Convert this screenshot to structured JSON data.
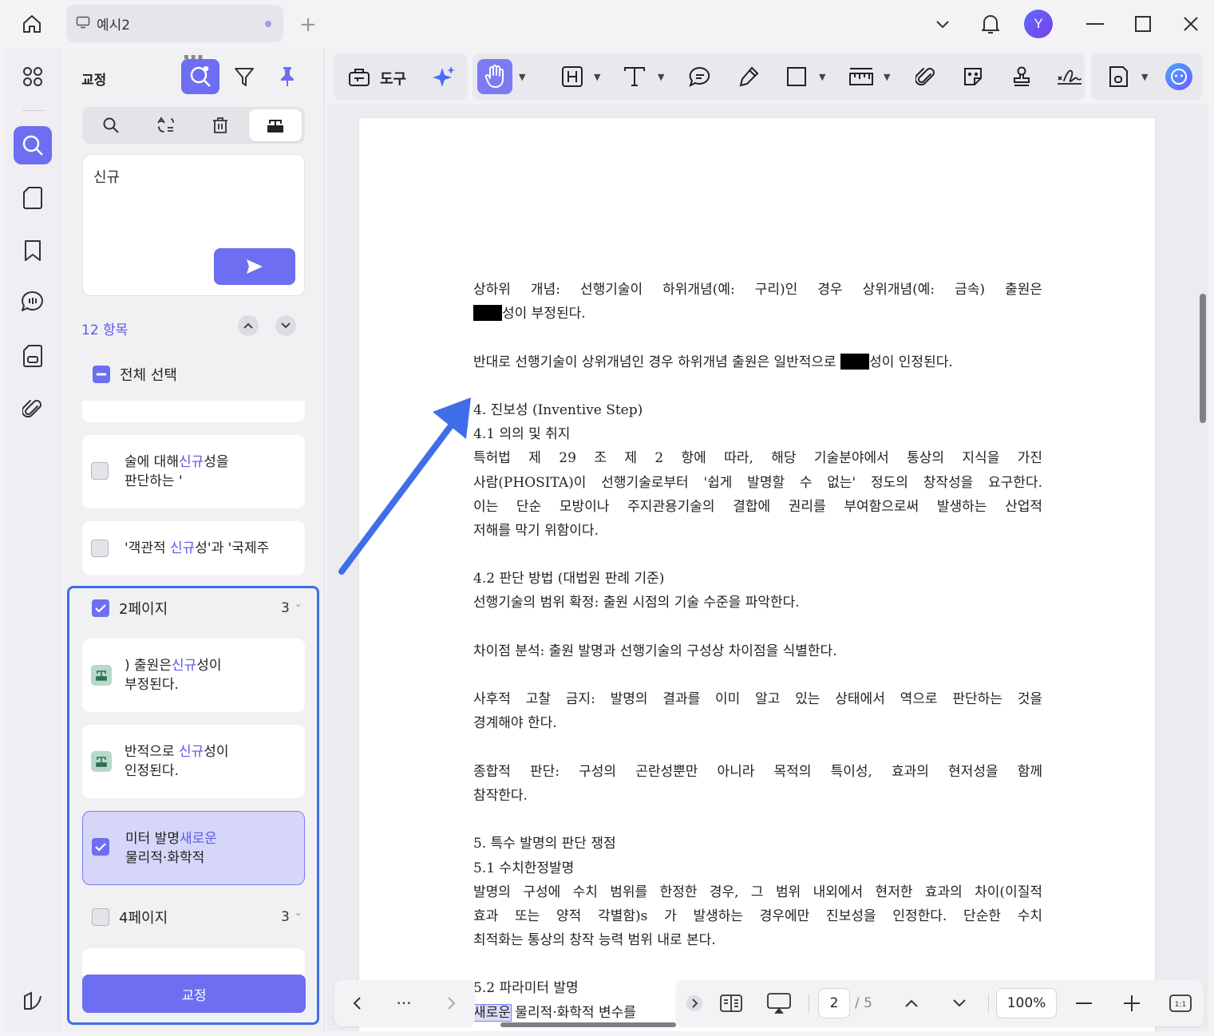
{
  "titlebar": {
    "tab_title": "예시2",
    "avatar_letter": "Y"
  },
  "panel": {
    "title": "교정",
    "search_query": "신규",
    "result_count": "12 항목",
    "select_all": "전체 선택",
    "apply_label": "교정",
    "results": [
      {
        "pre": "술에 대해",
        "hit": "신규",
        "post": "성을",
        "line2": "판단하는 '",
        "checked": false
      },
      {
        "pre": "'객관적 ",
        "hit": "신규",
        "post": "성'과 '국제주",
        "line2": "",
        "checked": false
      }
    ],
    "page_groups": [
      {
        "label": "2페이지",
        "count": "3",
        "checked": true,
        "items": [
          {
            "pre": ") 출원은",
            "hit": "신규",
            "post": "성이",
            "line2": "부정된다.",
            "type": "redacted"
          },
          {
            "pre": "반적으로 ",
            "hit": "신규",
            "post": "성이",
            "line2": "인정된다.",
            "type": "redacted"
          },
          {
            "pre": "미터 발명",
            "hit": "새로운",
            "post": "",
            "line2": "물리적·화학적",
            "type": "checked"
          }
        ]
      },
      {
        "label": "4페이지",
        "count": "3",
        "checked": false
      }
    ]
  },
  "toolbar": {
    "tools_label": "도구"
  },
  "document": {
    "lines": [
      {
        "text": "상하위 개념: 선행기술이 하위개념(예: 구리)인 경우 상위개념(예: 금속) 출원은",
        "just": true
      },
      {
        "pre": "",
        "redact": true,
        "post": "성이 부정된다.",
        "just": false
      },
      {
        "text": "",
        "just": false
      },
      {
        "pre": "반대로 선행기술이 상위개념인 경우 하위개념 출원은 일반적으로 ",
        "redact": true,
        "post": "성이 인정된다.",
        "just": false
      },
      {
        "text": "",
        "just": false
      },
      {
        "text": "4. 진보성 (Inventive Step)",
        "just": false
      },
      {
        "text": "4.1 의의 및 취지",
        "just": false
      },
      {
        "text": "특허법 제 29 조 제 2 항에 따라, 해당 기술분야에서 통상의 지식을 가진",
        "just": true
      },
      {
        "text": "사람(PHOSITA)이 선행기술로부터 '쉽게 발명할 수 없는' 정도의 창작성을 요구한다.",
        "just": true
      },
      {
        "text": "이는 단순 모방이나 주지관용기술의 결합에 권리를 부여함으로써 발생하는 산업적",
        "just": true
      },
      {
        "text": "저해를 막기 위함이다.",
        "just": false
      },
      {
        "text": "",
        "just": false
      },
      {
        "text": "4.2 판단 방법 (대법원 판례 기준)",
        "just": false
      },
      {
        "text": "선행기술의 범위 확정: 출원 시점의 기술 수준을 파악한다.",
        "just": false
      },
      {
        "text": "",
        "just": false
      },
      {
        "text": "차이점 분석: 출원 발명과 선행기술의 구성상 차이점을 식별한다.",
        "just": false
      },
      {
        "text": "",
        "just": false
      },
      {
        "text": "사후적 고찰 금지: 발명의 결과를 이미 알고 있는 상태에서 역으로 판단하는 것을",
        "just": true
      },
      {
        "text": "경계해야 한다.",
        "just": false
      },
      {
        "text": "",
        "just": false
      },
      {
        "text": "종합적 판단: 구성의 곤란성뿐만 아니라 목적의 특이성, 효과의 현저성을 함께",
        "just": true
      },
      {
        "text": "참작한다.",
        "just": false
      },
      {
        "text": "",
        "just": false
      },
      {
        "text": "5. 특수 발명의 판단 쟁점",
        "just": false
      },
      {
        "text": "5.1 수치한정발명",
        "just": false
      },
      {
        "text": "발명의 구성에 수치 범위를 한정한 경우, 그 범위 내외에서 현저한 효과의 차이(이질적",
        "just": true
      },
      {
        "text": "효과 또는 양적 각별함)s 가 발생하는 경우에만 진보성을 인정한다. 단순한 수치",
        "just": true
      },
      {
        "text": "최적화는 통상의 창작 능력 범위 내로 본다.",
        "just": false
      },
      {
        "text": "",
        "just": false
      },
      {
        "text": "5.2 파라미터 발명",
        "just": false
      },
      {
        "found": "새로운",
        "post": " 물리적·화학적 변수를",
        "just": false
      }
    ]
  },
  "bottombar": {
    "current_page": "2",
    "total_pages": "/ 5",
    "zoom": "100%",
    "fit_label": "1:1"
  },
  "colors": {
    "accent": "#6e6ef2",
    "highlight_text": "#5a5ae8",
    "annotation_arrow": "#3f6ee8"
  }
}
